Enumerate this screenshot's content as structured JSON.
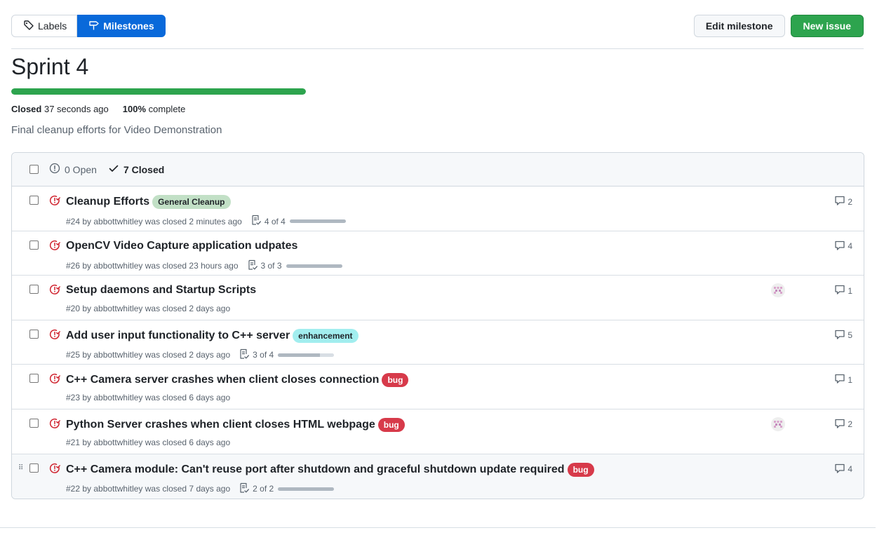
{
  "toolbar": {
    "labels_label": "Labels",
    "milestones_label": "Milestones",
    "edit_label": "Edit milestone",
    "new_issue_label": "New issue"
  },
  "milestone": {
    "title": "Sprint 4",
    "progress_percent": 100,
    "closed_label": "Closed",
    "closed_ago": "37 seconds ago",
    "percent_text": "100%",
    "complete_text": "complete",
    "description": "Final cleanup efforts for Video Demonstration"
  },
  "filter": {
    "open_label": "0 Open",
    "closed_label": "7 Closed"
  },
  "issues": [
    {
      "title": "Cleanup Efforts",
      "label": "General Cleanup",
      "label_bg": "#c2e0c6",
      "label_fg": "#1f2328",
      "meta": "#24 by abbottwhitley was closed 2 minutes ago",
      "tasks": "4 of 4",
      "task_fraction": 1.0,
      "comments": "2",
      "avatar": false
    },
    {
      "title": "OpenCV Video Capture application udpates",
      "label": "",
      "meta": "#26 by abbottwhitley was closed 23 hours ago",
      "tasks": "3 of 3",
      "task_fraction": 1.0,
      "comments": "4",
      "avatar": false
    },
    {
      "title": "Setup daemons and Startup Scripts",
      "label": "",
      "meta": "#20 by abbottwhitley was closed 2 days ago",
      "tasks": "",
      "comments": "1",
      "avatar": true
    },
    {
      "title": "Add user input functionality to C++ server",
      "label": "enhancement",
      "label_bg": "#a2eeef",
      "label_fg": "#1f2328",
      "meta": "#25 by abbottwhitley was closed 2 days ago",
      "tasks": "3 of 4",
      "task_fraction": 0.75,
      "comments": "5",
      "avatar": false
    },
    {
      "title": "C++ Camera server crashes when client closes connection",
      "label": "bug",
      "label_bg": "#d73a4a",
      "label_fg": "#ffffff",
      "meta": "#23 by abbottwhitley was closed 6 days ago",
      "tasks": "",
      "comments": "1",
      "avatar": false
    },
    {
      "title": "Python Server crashes when client closes HTML webpage",
      "label": "bug",
      "label_bg": "#d73a4a",
      "label_fg": "#ffffff",
      "meta": "#21 by abbottwhitley was closed 6 days ago",
      "tasks": "",
      "comments": "2",
      "avatar": true
    },
    {
      "title": "C++ Camera module: Can't reuse port after shutdown and graceful shutdown update required",
      "label": "bug",
      "label_bg": "#d73a4a",
      "label_fg": "#ffffff",
      "meta": "#22 by abbottwhitley was closed 7 days ago",
      "tasks": "2 of 2",
      "task_fraction": 1.0,
      "comments": "4",
      "avatar": false,
      "hover": true
    }
  ],
  "colors": {
    "closed_icon": "#cf222e",
    "accent_blue": "#0969da",
    "accent_green": "#2da44e"
  },
  "icons": {
    "labels": "tag-icon",
    "milestones": "milestone-icon",
    "open": "issue-opened-icon",
    "closed": "check-icon",
    "issue_state": "issue-closed-icon",
    "tasks": "checklist-icon",
    "comments": "comment-icon"
  }
}
